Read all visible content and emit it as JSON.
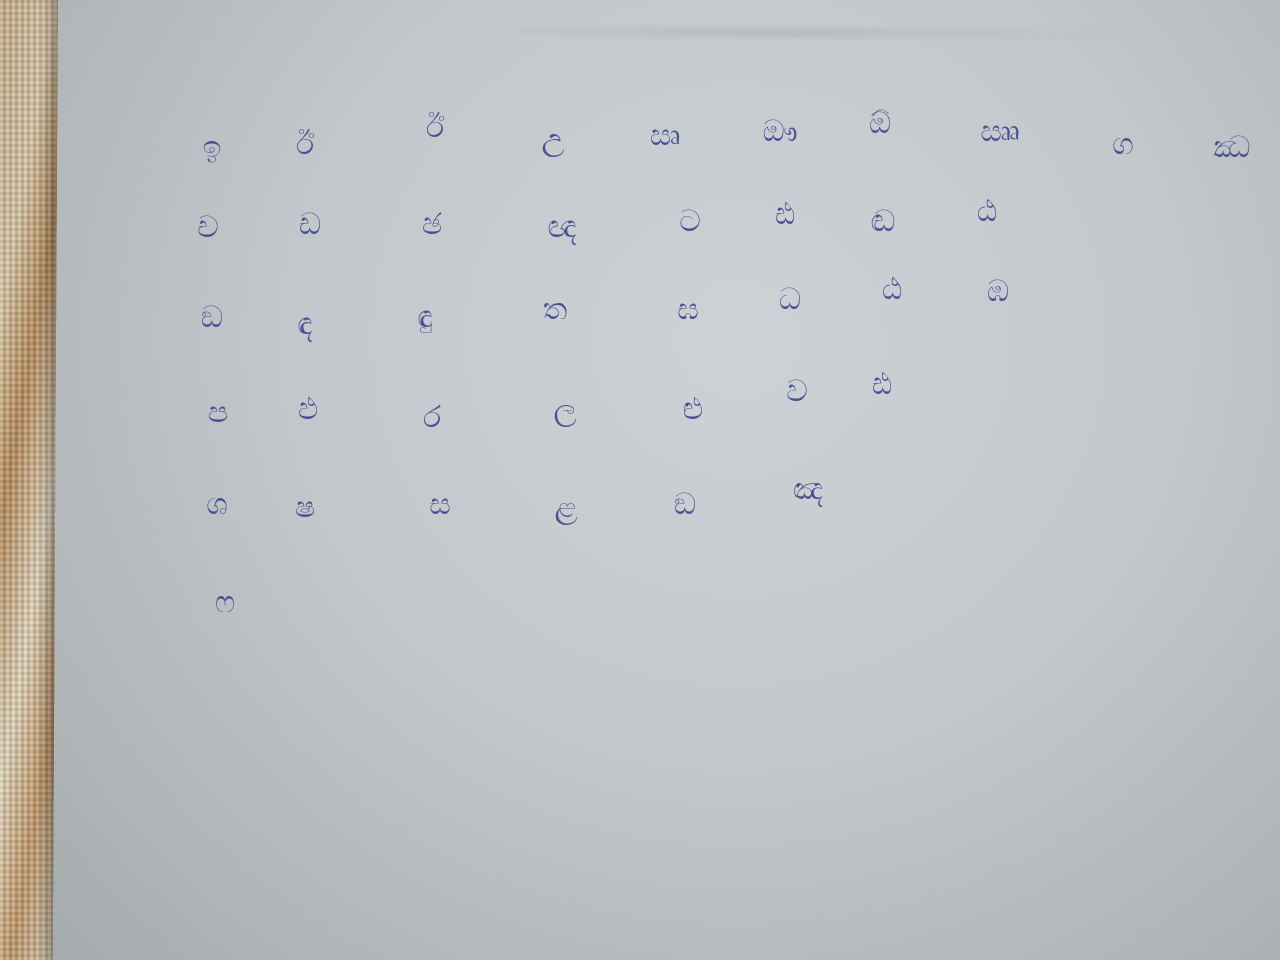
{
  "handwritten_letters": {
    "rows": [
      [
        "ඉ",
        "ඊ",
        "ඊ",
        "උ",
        "ඍ",
        "ඖ",
        "ඕ",
        "ඎ",
        "ග",
        "ඣ"
      ],
      [
        "ච",
        "ඩ",
        "ඡ",
        "ඥ",
        "ට",
        "ඪ",
        "ඬ",
        "ඨ"
      ],
      [
        "ඞ",
        "ඳ",
        "ඳු",
        "ත",
        "ඝ",
        "ධ",
        "ඨ",
        "ඹ"
      ],
      [
        "ප",
        "ඵ",
        "ර",
        "ල",
        "ළු",
        "ව",
        "ඪ"
      ],
      [
        "ශ",
        "ෂ",
        "ස",
        "ළ",
        "ඞ",
        "ඤ"
      ],
      [
        "ෆ"
      ]
    ],
    "ink_color": "#3a3f8a",
    "paper_color": "#c6ccd0"
  }
}
